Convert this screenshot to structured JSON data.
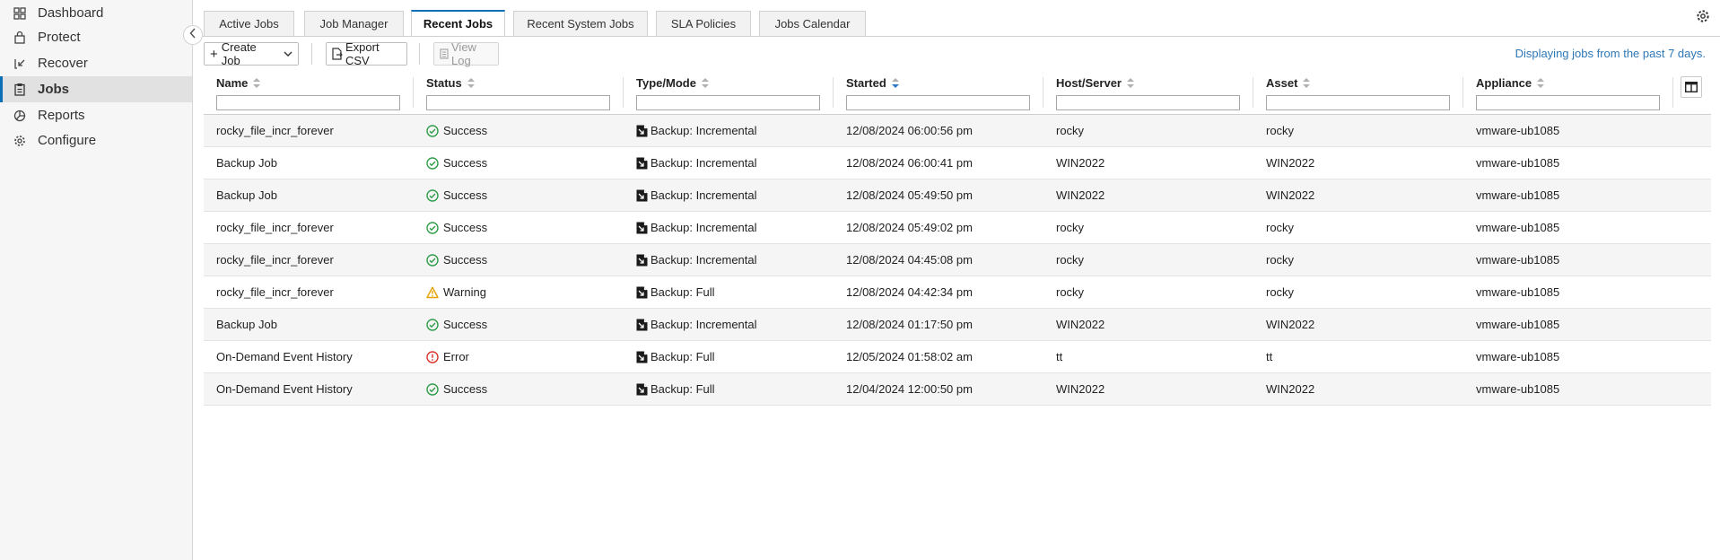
{
  "sidebar": {
    "items": [
      {
        "label": "Dashboard",
        "icon": "dashboard-icon"
      },
      {
        "label": "Protect",
        "icon": "lock-icon"
      },
      {
        "label": "Recover",
        "icon": "recover-icon"
      },
      {
        "label": "Jobs",
        "icon": "clipboard-icon"
      },
      {
        "label": "Reports",
        "icon": "reports-icon"
      },
      {
        "label": "Configure",
        "icon": "gear-icon"
      }
    ],
    "active": "Jobs"
  },
  "tabs": [
    {
      "label": "Active Jobs"
    },
    {
      "label": "Job Manager"
    },
    {
      "label": "Recent Jobs"
    },
    {
      "label": "Recent System Jobs"
    },
    {
      "label": "SLA Policies"
    },
    {
      "label": "Jobs Calendar"
    }
  ],
  "active_tab": "Recent Jobs",
  "toolbar": {
    "create_job_label": "Create Job",
    "export_csv_label": "Export CSV",
    "view_log_label": "View Log",
    "info_text": "Displaying jobs from the past 7 days."
  },
  "table": {
    "columns": [
      {
        "label": "Name"
      },
      {
        "label": "Status"
      },
      {
        "label": "Type/Mode"
      },
      {
        "label": "Started"
      },
      {
        "label": "Host/Server"
      },
      {
        "label": "Asset"
      },
      {
        "label": "Appliance"
      }
    ],
    "sorted_column": "Started",
    "rows": [
      {
        "name": "rocky_file_incr_forever",
        "status": "Success",
        "type": "Backup: Incremental",
        "started": "12/08/2024 06:00:56 pm",
        "host": "rocky",
        "asset": "rocky",
        "appliance": "vmware-ub1085"
      },
      {
        "name": "Backup Job",
        "status": "Success",
        "type": "Backup: Incremental",
        "started": "12/08/2024 06:00:41 pm",
        "host": "WIN2022",
        "asset": "WIN2022",
        "appliance": "vmware-ub1085"
      },
      {
        "name": "Backup Job",
        "status": "Success",
        "type": "Backup: Incremental",
        "started": "12/08/2024 05:49:50 pm",
        "host": "WIN2022",
        "asset": "WIN2022",
        "appliance": "vmware-ub1085"
      },
      {
        "name": "rocky_file_incr_forever",
        "status": "Success",
        "type": "Backup: Incremental",
        "started": "12/08/2024 05:49:02 pm",
        "host": "rocky",
        "asset": "rocky",
        "appliance": "vmware-ub1085"
      },
      {
        "name": "rocky_file_incr_forever",
        "status": "Success",
        "type": "Backup: Incremental",
        "started": "12/08/2024 04:45:08 pm",
        "host": "rocky",
        "asset": "rocky",
        "appliance": "vmware-ub1085"
      },
      {
        "name": "rocky_file_incr_forever",
        "status": "Warning",
        "type": "Backup: Full",
        "started": "12/08/2024 04:42:34 pm",
        "host": "rocky",
        "asset": "rocky",
        "appliance": "vmware-ub1085"
      },
      {
        "name": "Backup Job",
        "status": "Success",
        "type": "Backup: Incremental",
        "started": "12/08/2024 01:17:50 pm",
        "host": "WIN2022",
        "asset": "WIN2022",
        "appliance": "vmware-ub1085"
      },
      {
        "name": "On-Demand Event History",
        "status": "Error",
        "type": "Backup: Full",
        "started": "12/05/2024 01:58:02 am",
        "host": "tt",
        "asset": "tt",
        "appliance": "vmware-ub1085"
      },
      {
        "name": "On-Demand Event History",
        "status": "Success",
        "type": "Backup: Full",
        "started": "12/04/2024 12:00:50 pm",
        "host": "WIN2022",
        "asset": "WIN2022",
        "appliance": "vmware-ub1085"
      }
    ]
  },
  "colors": {
    "accent": "#0b6fb8",
    "success": "#2e9e48",
    "warning": "#e6a000",
    "error": "#d9342b",
    "info_text": "#2f78b8"
  }
}
